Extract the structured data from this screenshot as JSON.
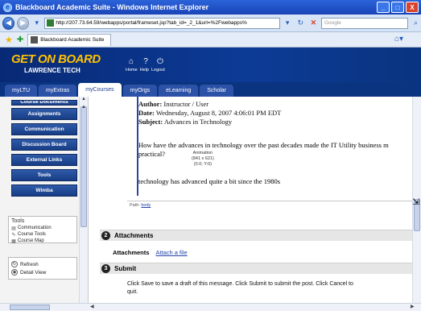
{
  "window": {
    "title": "Blackboard Academic Suite - Windows Internet Explorer",
    "buttons": {
      "minimize": "_",
      "maximize": "□",
      "close": "X"
    }
  },
  "addressbar": {
    "url": "http://207.73.64.59/webapps/portal/frameset.jsp?tab_id=_2_1&url=%2Fwebapps%",
    "search_placeholder": "Google"
  },
  "tabbar": {
    "tab_label": "Blackboard Academic Suite"
  },
  "header": {
    "logo_line1": "GET ON BOARD",
    "logo_line2": "LAWRENCE TECH",
    "links": [
      "Home",
      "Help",
      "Logout"
    ]
  },
  "course_tabs": [
    "myLTU",
    "myExtras",
    "myCourses",
    "myOrgs",
    "eLearning",
    "Scholar"
  ],
  "course_tabs_active": "myCourses",
  "left_menu": {
    "partial_item": "Course Documents",
    "items": [
      "Assignments",
      "Communication",
      "Discussion Board",
      "External Links",
      "Tools",
      "Wimba"
    ],
    "tools_heading": "Tools",
    "tools": [
      "Communication",
      "Course Tools",
      "Course Map"
    ],
    "view_items": [
      "Refresh",
      "Detail View"
    ]
  },
  "message": {
    "author_label": "Author:",
    "author_value": "Instructor / User",
    "date_label": "Date:",
    "date_value": "Wednesday, August 8, 2007 4:06:01 PM EDT",
    "subject_label": "Subject:",
    "subject_value": "Advances in Technology",
    "question_line1": "How have the advances in technology over the past decades made the IT Utility business m",
    "question_line2": "practical?",
    "animation_label": "Animation",
    "animation_size": "(841 x 621)",
    "animation_coords": "(0.0; Y:0)",
    "reply": "technology has advanced quite a bit since the 1980s"
  },
  "pathbar": {
    "label": "Path:",
    "value": "body"
  },
  "attachments": {
    "number": "2",
    "heading": "Attachments",
    "label": "Attachments",
    "link": "Attach a file"
  },
  "submit": {
    "number": "3",
    "heading": "Submit",
    "text_line1": "Click Save to save a draft of this message. Click Submit to submit the post. Click Cancel to",
    "text_line2": "quit."
  }
}
